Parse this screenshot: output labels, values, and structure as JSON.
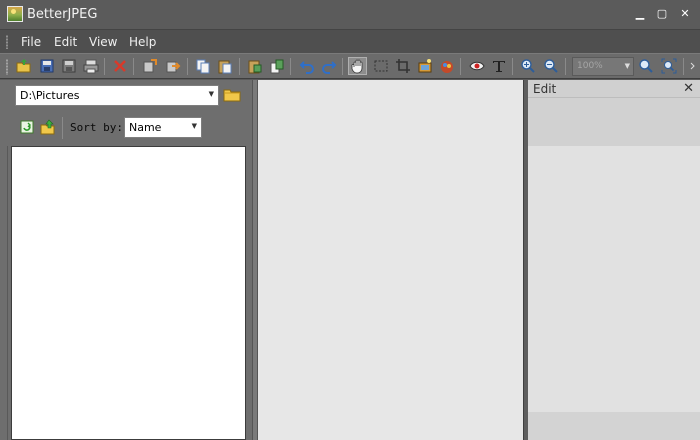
{
  "window": {
    "title": "BetterJPEG",
    "controls": {
      "minimize": "▁",
      "maximize": "▢",
      "close": "✕"
    }
  },
  "menu": {
    "items": [
      {
        "label": "File"
      },
      {
        "label": "Edit"
      },
      {
        "label": "View"
      },
      {
        "label": "Help"
      }
    ]
  },
  "toolbar": {
    "zoom_value": "100%",
    "icons": [
      "open-icon",
      "save-icon",
      "save-as-icon",
      "print-icon",
      "delete-icon",
      "copy-file-icon",
      "move-file-icon",
      "copy-icon",
      "paste-icon",
      "paste-special-icon",
      "paste-new-icon",
      "undo-icon",
      "redo-icon",
      "hand-tool-icon",
      "select-rect-icon",
      "crop-icon",
      "auto-fix-icon",
      "color-icon",
      "red-eye-icon",
      "text-icon",
      "zoom-in-icon",
      "zoom-out-icon",
      "zoom-fit-icon",
      "zoom-actual-icon"
    ]
  },
  "browser": {
    "path": "D:\\Pictures",
    "sort_label": "Sort by:",
    "sort_value": "Name"
  },
  "edit_panel": {
    "title": "Edit",
    "close": "✕"
  },
  "colors": {
    "background": "#5a5a5a",
    "toolbar": "#6b6b6b",
    "canvas": "#e7e7e7"
  }
}
